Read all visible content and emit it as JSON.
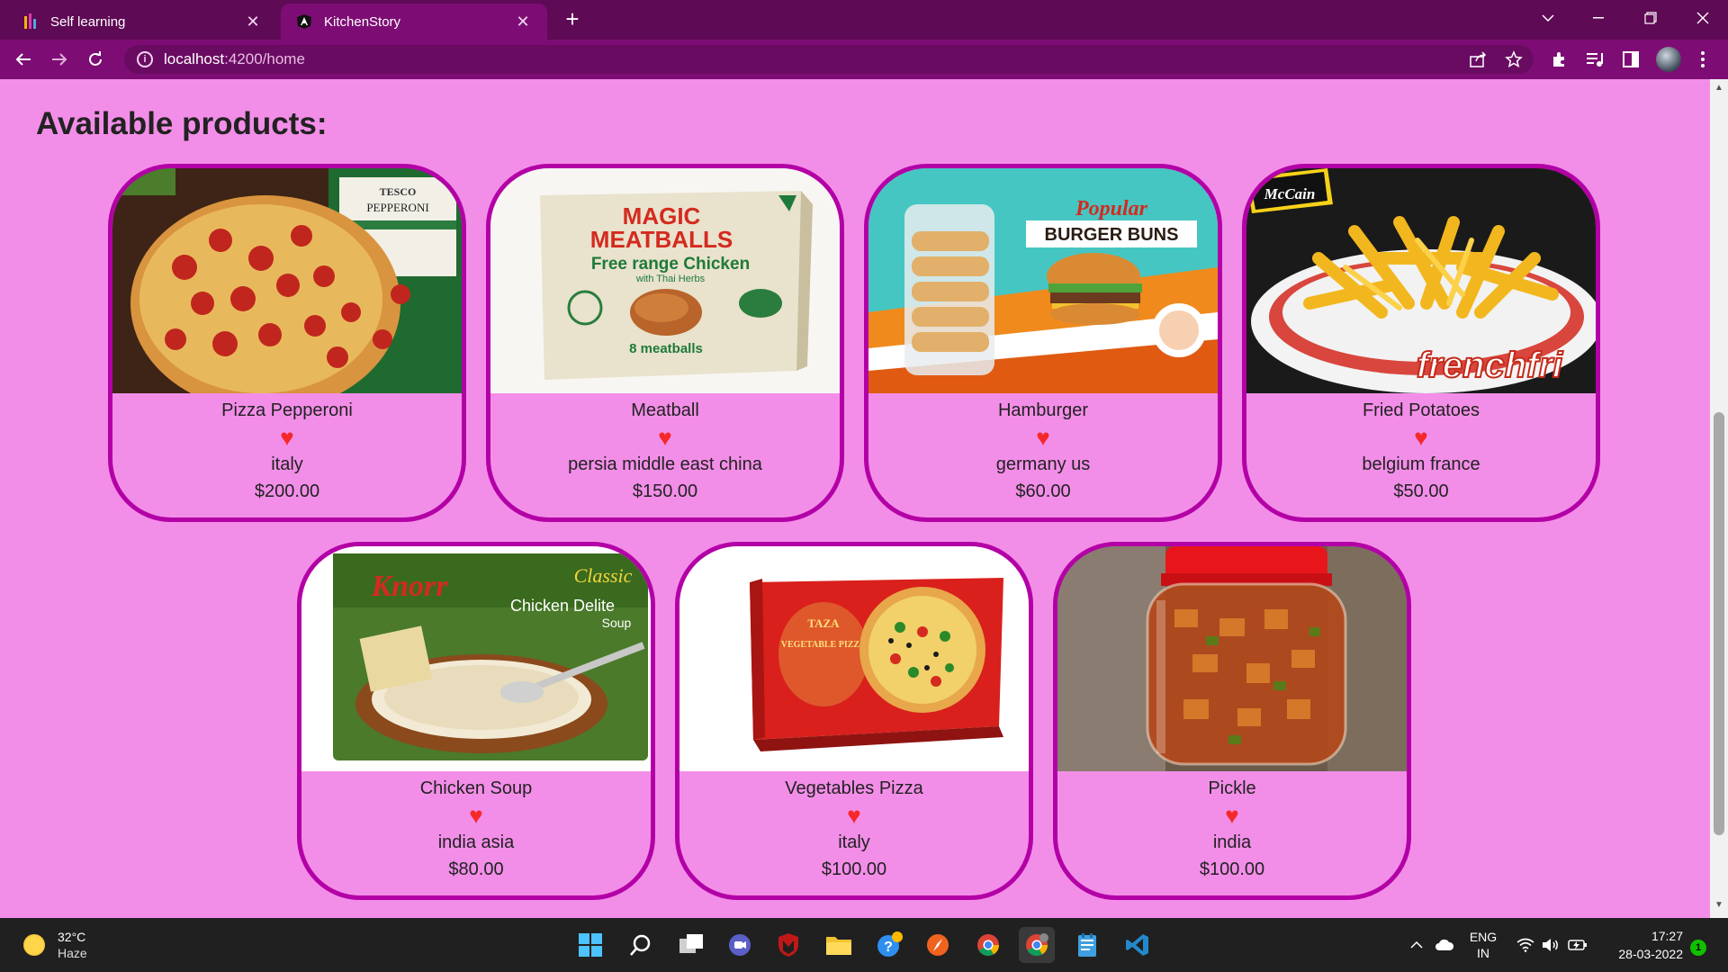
{
  "browser": {
    "tabs": [
      {
        "title": "Self learning",
        "active": false
      },
      {
        "title": "KitchenStory",
        "active": true
      }
    ],
    "new_tab_symbol": "+",
    "tab_close_symbol": "✕",
    "url_host": "localhost",
    "url_path": ":4200/home",
    "icons": [
      "back-arrow-icon",
      "forward-arrow-icon",
      "reload-icon",
      "info-icon",
      "share-icon",
      "star-icon",
      "extensions-icon",
      "media-icon",
      "side-panel-icon",
      "profile-avatar",
      "menu-dots-icon"
    ]
  },
  "page": {
    "heading": "Available products:",
    "products": [
      {
        "name": "Pizza Pepperoni",
        "origin": "italy",
        "price": "$200.00",
        "image": "pepperoni-pizza-image",
        "favorite": true
      },
      {
        "name": "Meatball",
        "origin": "persia middle east china",
        "price": "$150.00",
        "image": "meatballs-box-image",
        "favorite": true
      },
      {
        "name": "Hamburger",
        "origin": "germany us",
        "price": "$60.00",
        "image": "burger-buns-image",
        "favorite": true
      },
      {
        "name": "Fried Potatoes",
        "origin": "belgium france",
        "price": "$50.00",
        "image": "french-fries-image",
        "favorite": true
      },
      {
        "name": "Chicken Soup",
        "origin": "india asia",
        "price": "$80.00",
        "image": "chicken-soup-image",
        "favorite": true
      },
      {
        "name": "Vegetables Pizza",
        "origin": "italy",
        "price": "$100.00",
        "image": "vegetable-pizza-box-image",
        "favorite": true
      },
      {
        "name": "Pickle",
        "origin": "india",
        "price": "$100.00",
        "image": "pickle-jar-image",
        "favorite": true
      }
    ],
    "heart_symbol": "♥",
    "image_text": {
      "pepperoni_brand": "TESCO",
      "pepperoni_label": "PEPPERONI",
      "meatball_title1": "MAGIC",
      "meatball_title2": "MEATBALLS",
      "meatball_sub": "Free range Chicken",
      "meatball_sub2": "with Thai Herbs",
      "meatball_count": "8 meatballs",
      "burger_brand": "Popular",
      "burger_label": "BURGER BUNS",
      "fries_brand": "McCain",
      "fries_label": "frenchfri",
      "soup_brand": "Knorr",
      "soup_label": "Chicken Delite",
      "soup_sub": "Soup",
      "soup_classic": "Classic",
      "vpizza_brand": "TAZA",
      "vpizza_label": "VEGETABLE PIZZA"
    },
    "colors": {
      "background": "#f38ee8",
      "card_border": "#b300a6",
      "heart": "#f5282a"
    }
  },
  "taskbar": {
    "weather_temp": "32°C",
    "weather_condition": "Haze",
    "language_line1": "ENG",
    "language_line2": "IN",
    "time": "17:27",
    "date": "28-03-2022",
    "notification_count": "1"
  }
}
